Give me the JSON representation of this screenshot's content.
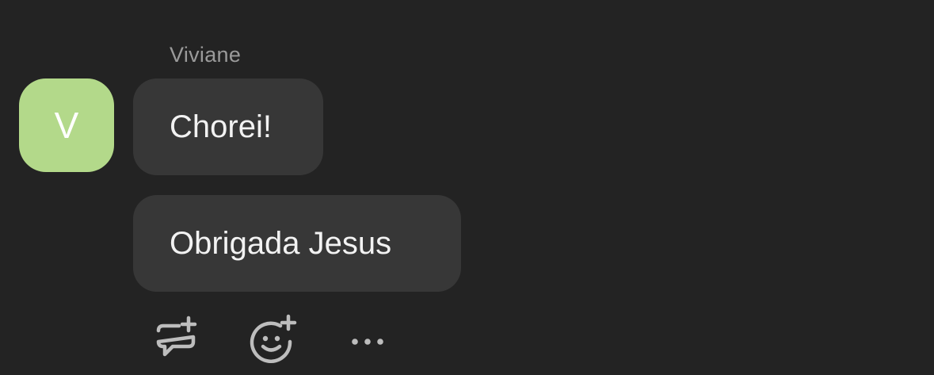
{
  "message_group": {
    "sender": {
      "name": "Viviane",
      "avatar_initial": "V",
      "avatar_color": "#b3d98a"
    },
    "messages": [
      {
        "text": "Chorei!"
      },
      {
        "text": "Obrigada Jesus"
      }
    ],
    "actions": [
      {
        "icon": "reply-thread-icon"
      },
      {
        "icon": "add-reaction-icon"
      },
      {
        "icon": "more-options-icon"
      }
    ]
  },
  "colors": {
    "background": "#232323",
    "bubble": "#373737",
    "text": "#f2f2f2",
    "muted": "#9a9a9a",
    "icon": "#bdbdbd"
  }
}
